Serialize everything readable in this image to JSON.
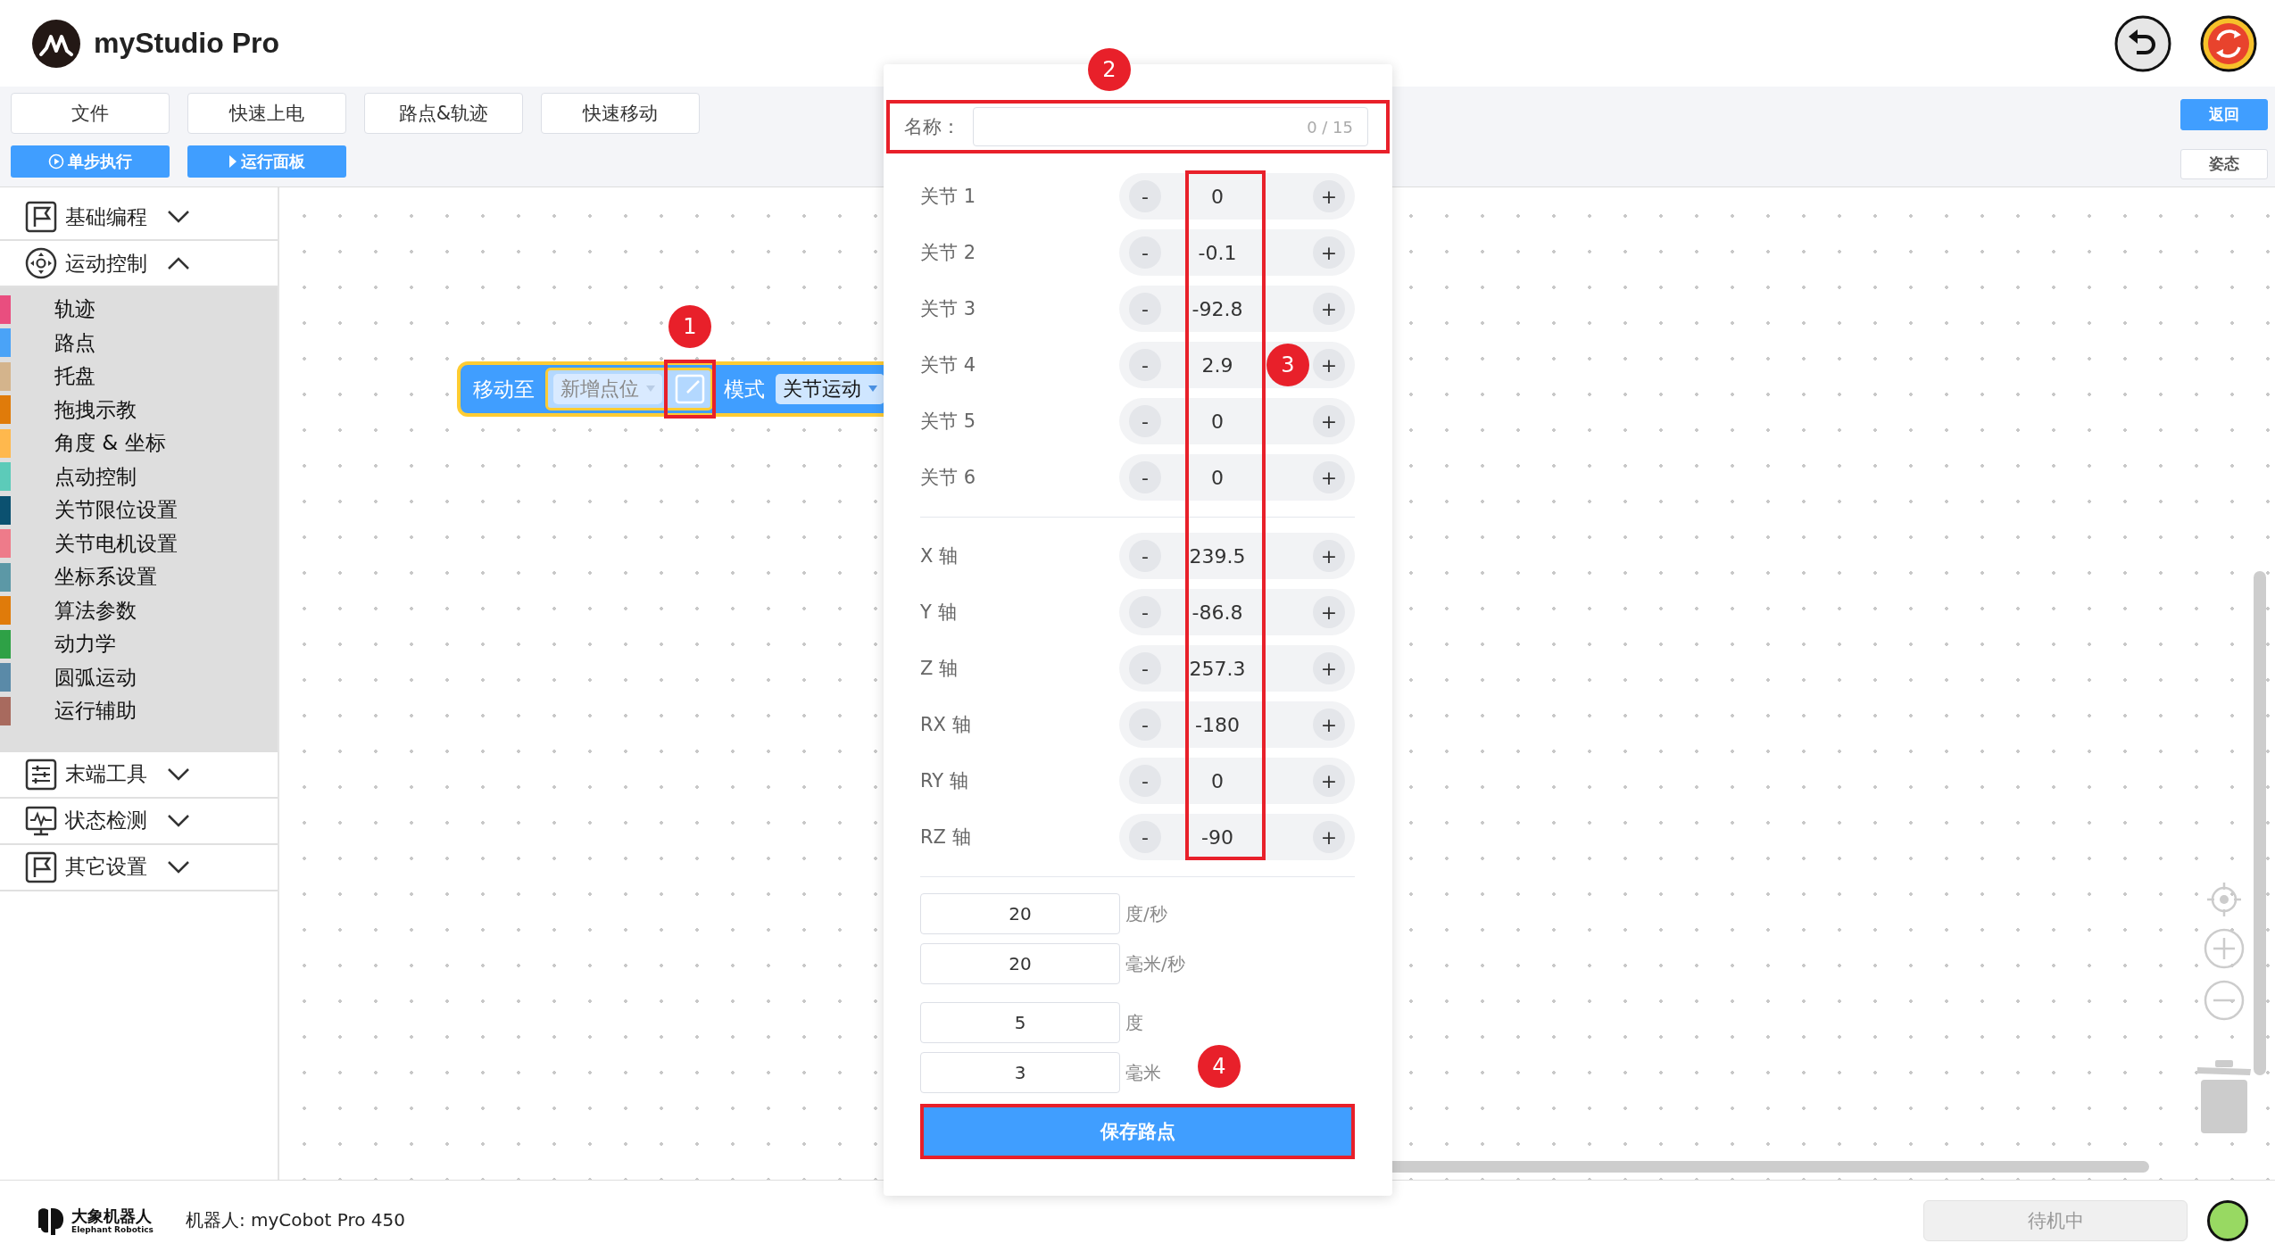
{
  "app": {
    "title": "myStudio Pro"
  },
  "header_icons": [
    {
      "kind": "undo"
    },
    {
      "kind": "emergency"
    }
  ],
  "menu": [
    "文件",
    "快速上电",
    "路点&轨迹",
    "快速移动"
  ],
  "actions": [
    {
      "label": "单步执行",
      "kind": "step"
    },
    {
      "label": "运行面板",
      "kind": "run"
    }
  ],
  "right_actions": [
    {
      "label": "返回",
      "primary": true
    },
    {
      "label": "姿态",
      "primary": false
    }
  ],
  "sidebar": {
    "categories": [
      {
        "label": "基础编程",
        "expanded": false
      },
      {
        "label": "运动控制",
        "expanded": true,
        "children": [
          {
            "label": "轨迹",
            "color": "#e94e7f"
          },
          {
            "label": "路点",
            "color": "#4aa3f7"
          },
          {
            "label": "托盘",
            "color": "#d4b48c"
          },
          {
            "label": "拖拽示教",
            "color": "#e07b0a"
          },
          {
            "label": "角度 & 坐标",
            "color": "#ffb84d"
          },
          {
            "label": "点动控制",
            "color": "#5ccbb9"
          },
          {
            "label": "关节限位设置",
            "color": "#0b5170"
          },
          {
            "label": "关节电机设置",
            "color": "#ee7b8a"
          },
          {
            "label": "坐标系设置",
            "color": "#5c98a6"
          },
          {
            "label": "算法参数",
            "color": "#e07b0a"
          },
          {
            "label": "动力学",
            "color": "#2ea146"
          },
          {
            "label": "圆弧运动",
            "color": "#5a8aa8"
          },
          {
            "label": "运行辅助",
            "color": "#a86a5e"
          }
        ]
      },
      {
        "label": "末端工具",
        "expanded": false
      },
      {
        "label": "状态检测",
        "expanded": false
      },
      {
        "label": "其它设置",
        "expanded": false
      }
    ]
  },
  "block": {
    "label": "移动至",
    "point": "新增点位",
    "mode_label": "模式",
    "mode": "关节运动"
  },
  "dialog": {
    "name_label": "名称：",
    "name_counter": "0 / 15",
    "joints": [
      {
        "label": "关节 1",
        "value": "0",
        "minus": "-",
        "plus": "+"
      },
      {
        "label": "关节 2",
        "value": "-0.1",
        "minus": "-",
        "plus": "+"
      },
      {
        "label": "关节 3",
        "value": "-92.8",
        "minus": "-",
        "plus": "+"
      },
      {
        "label": "关节 4",
        "value": "2.9",
        "minus": "-",
        "plus": "+"
      },
      {
        "label": "关节 5",
        "value": "0",
        "minus": "-",
        "plus": "+"
      },
      {
        "label": "关节 6",
        "value": "0",
        "minus": "-",
        "plus": "+"
      }
    ],
    "axes": [
      {
        "label": "X 轴",
        "value": "239.5",
        "minus": "-",
        "plus": "+"
      },
      {
        "label": "Y 轴",
        "value": "-86.8",
        "minus": "-",
        "plus": "+"
      },
      {
        "label": "Z 轴",
        "value": "257.3",
        "minus": "-",
        "plus": "+"
      },
      {
        "label": "RX 轴",
        "value": "-180",
        "minus": "-",
        "plus": "+"
      },
      {
        "label": "RY 轴",
        "value": "0",
        "minus": "-",
        "plus": "+"
      },
      {
        "label": "RZ 轴",
        "value": "-90",
        "minus": "-",
        "plus": "+"
      }
    ],
    "speed_fields": [
      {
        "value": "20",
        "unit": "度/秒"
      },
      {
        "value": "20",
        "unit": "毫米/秒"
      }
    ],
    "tolerance_fields": [
      {
        "value": "5",
        "unit": "度"
      },
      {
        "value": "3",
        "unit": "毫米"
      }
    ],
    "save_button": "保存路点"
  },
  "annotations": [
    {
      "number": "1"
    },
    {
      "number": "2"
    },
    {
      "number": "3"
    },
    {
      "number": "4"
    }
  ],
  "footer": {
    "brand": "大象机器人",
    "brand_sub": "Elephant Robotics",
    "robot": "机器人: myCobot Pro 450",
    "status": "待机中",
    "connected": true
  }
}
